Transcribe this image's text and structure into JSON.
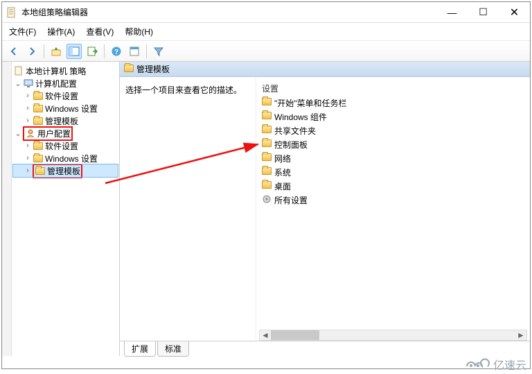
{
  "window": {
    "title": "本地组策略编辑器",
    "controls": {
      "min": "—",
      "max": "☐",
      "close": "✕"
    }
  },
  "menubar": {
    "file": "文件(F)",
    "action": "操作(A)",
    "view": "查看(V)",
    "help": "帮助(H)"
  },
  "tree": {
    "root": "本地计算机 策略",
    "computer_cfg": "计算机配置",
    "cc_soft": "软件设置",
    "cc_win": "Windows 设置",
    "cc_tmpl": "管理模板",
    "user_cfg": "用户配置",
    "uc_soft": "软件设置",
    "uc_win": "Windows 设置",
    "uc_tmpl": "管理模板"
  },
  "path": {
    "label": "管理模板"
  },
  "desc": {
    "text": "选择一个项目来查看它的描述。"
  },
  "list": {
    "header": "设置",
    "items": [
      "\"开始\"菜单和任务栏",
      "Windows 组件",
      "共享文件夹",
      "控制面板",
      "网络",
      "系统",
      "桌面",
      "所有设置"
    ]
  },
  "tabs": {
    "extended": "扩展",
    "standard": "标准"
  },
  "logo": {
    "text": "亿速云"
  }
}
